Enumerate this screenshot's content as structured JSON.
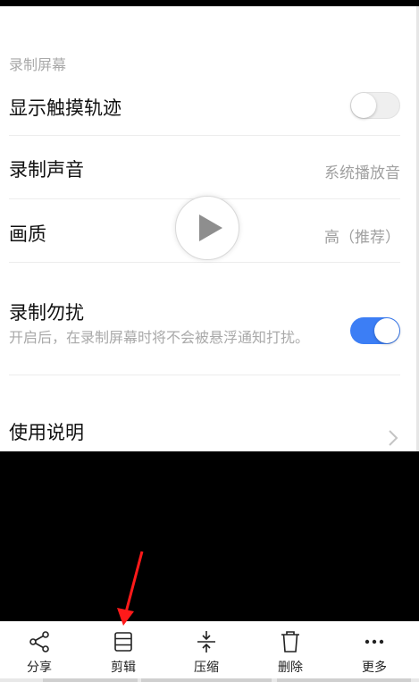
{
  "settings": {
    "section_title": "录制屏幕",
    "show_touch_trail": {
      "label": "显示触摸轨迹",
      "enabled": false
    },
    "record_sound": {
      "label": "录制声音",
      "value": "系统播放音"
    },
    "quality": {
      "label": "画质",
      "value": "高（推荐）"
    },
    "do_not_disturb": {
      "label": "录制勿扰",
      "description": "开启后，在录制屏幕时将不会被悬浮通知打扰。",
      "enabled": true
    },
    "instructions": {
      "label": "使用说明"
    }
  },
  "player": {
    "play_icon": "play-icon"
  },
  "toolbar": {
    "share": {
      "label": "分享",
      "icon": "share-icon"
    },
    "edit": {
      "label": "剪辑",
      "icon": "edit-icon"
    },
    "compress": {
      "label": "压缩",
      "icon": "compress-icon"
    },
    "delete": {
      "label": "删除",
      "icon": "trash-icon"
    },
    "more": {
      "label": "更多",
      "icon": "more-icon"
    }
  },
  "colors": {
    "toggle_on": "#3c7ef5",
    "annotation_arrow": "#ff1a1a"
  }
}
